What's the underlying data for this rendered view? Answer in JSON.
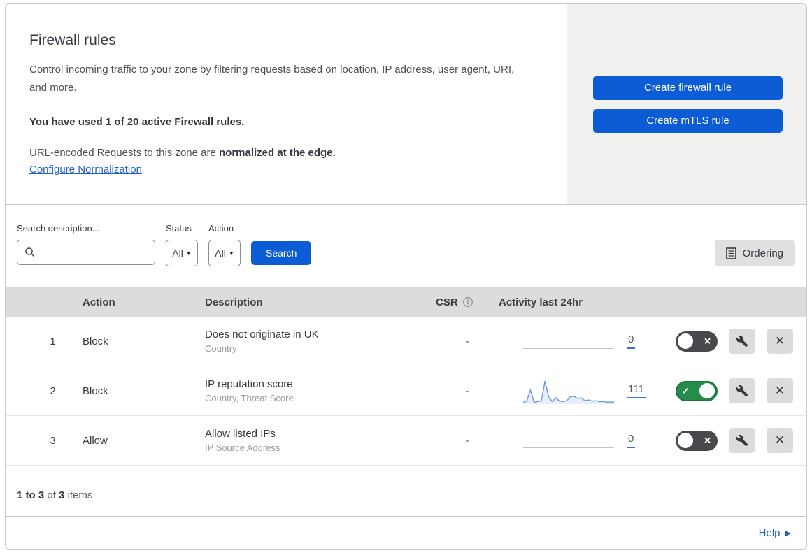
{
  "header": {
    "title": "Firewall rules",
    "description": "Control incoming traffic to your zone by filtering requests based on location, IP address, user agent, URI, and more.",
    "usage_notice": "You have used 1 of 20 active Firewall rules.",
    "normalization_prefix": "URL-encoded Requests to this zone are",
    "normalization_emphasis": "normalized at the edge.",
    "configure_link": "Configure Normalization",
    "create_firewall_button": "Create firewall rule",
    "create_mtls_button": "Create mTLS rule"
  },
  "filters": {
    "search_label": "Search description...",
    "search_value": "",
    "status_label": "Status",
    "status_value": "All",
    "action_label": "Action",
    "action_value": "All",
    "search_button": "Search",
    "ordering_button": "Ordering"
  },
  "table": {
    "headers": {
      "action": "Action",
      "description": "Description",
      "csr": "CSR",
      "activity": "Activity last 24hr"
    },
    "rows": [
      {
        "index": "1",
        "action": "Block",
        "description": "Does not originate in UK",
        "fields": "Country",
        "csr": "-",
        "count": "0",
        "enabled": false,
        "sparkline": []
      },
      {
        "index": "2",
        "action": "Block",
        "description": "IP reputation score",
        "fields": "Country, Threat Score",
        "csr": "-",
        "count": "111",
        "enabled": true,
        "sparkline": [
          5,
          10,
          60,
          5,
          8,
          12,
          100,
          30,
          8,
          25,
          10,
          8,
          12,
          30,
          32,
          22,
          25,
          12,
          15,
          10,
          12,
          8,
          8,
          6,
          6,
          6
        ]
      },
      {
        "index": "3",
        "action": "Allow",
        "description": "Allow listed IPs",
        "fields": "IP Source Address",
        "csr": "-",
        "count": "0",
        "enabled": false,
        "sparkline": []
      }
    ],
    "footer": {
      "range": "1 to 3",
      "of_word": "of",
      "total": "3",
      "items_word": "items"
    }
  },
  "help_link": "Help",
  "icons": {
    "search_icon": "magnifier",
    "info_icon": "circled-i",
    "ordering_icon": "list-page",
    "wrench_icon": "wrench",
    "close": "✕",
    "toggle_on_check": "✓",
    "toggle_off_cross": "✕",
    "dropdown_caret": "▼",
    "help_arrow": "▶"
  },
  "colors": {
    "accent_blue": "#0b5cd5",
    "link_blue": "#2161c7",
    "toggle_on_green": "#268c4c",
    "toggle_off_gray": "#47494d",
    "sparkline_blue": "#7099e6",
    "table_header_gray": "#dcdcdc",
    "panel_gray": "#f1f1f0"
  }
}
